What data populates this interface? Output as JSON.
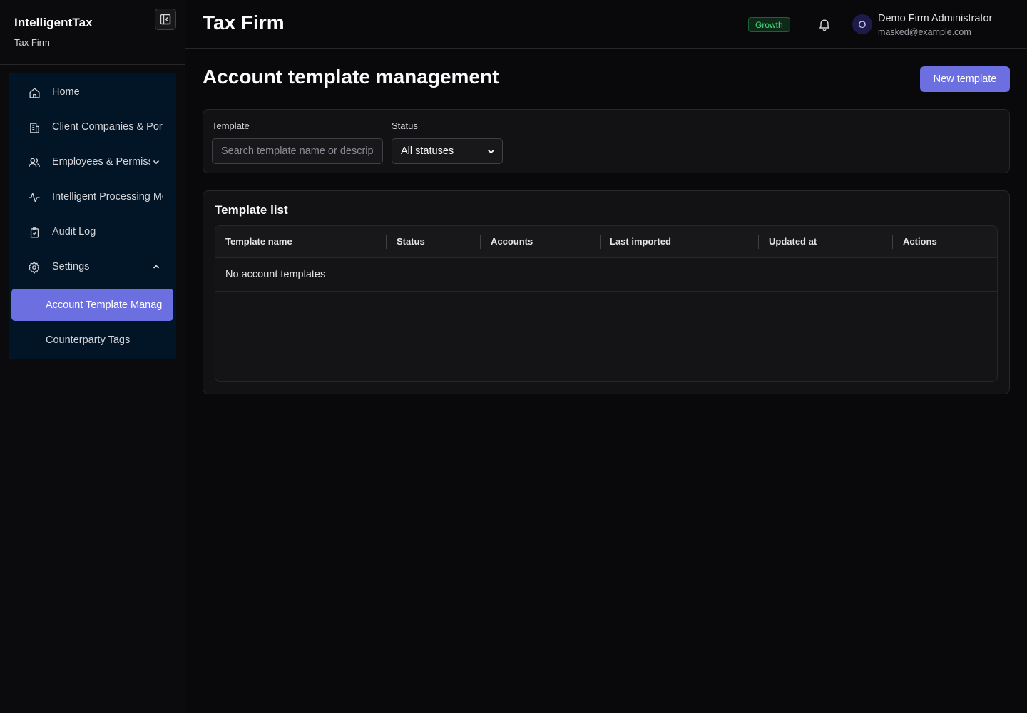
{
  "brand": {
    "title": "IntelligentTax",
    "subtitle": "Tax Firm"
  },
  "sidebar": {
    "items": [
      {
        "label": "Home",
        "icon": "home-icon"
      },
      {
        "label": "Client Companies & Portfolios",
        "icon": "building-icon"
      },
      {
        "label": "Employees & Permissions",
        "icon": "users-icon",
        "expandable": true
      },
      {
        "label": "Intelligent Processing Monitor",
        "icon": "activity-icon"
      },
      {
        "label": "Audit Log",
        "icon": "clipboard-icon"
      },
      {
        "label": "Settings",
        "icon": "gear-icon",
        "expanded": true
      }
    ],
    "sub_items": [
      {
        "label": "Account Template Management",
        "active": true
      },
      {
        "label": "Counterparty Tags",
        "active": false
      }
    ]
  },
  "header": {
    "title": "Tax Firm",
    "plan_badge": "Growth",
    "user_initial": "O",
    "user_name": "Demo Firm Administrator",
    "user_email": "masked@example.com"
  },
  "main": {
    "page_title": "Account template management",
    "new_button": "New template",
    "filters": {
      "template_label": "Template",
      "search_placeholder": "Search template name or description",
      "status_label": "Status",
      "status_value": "All statuses"
    },
    "list": {
      "title": "Template list",
      "columns": [
        "Template name",
        "Status",
        "Accounts",
        "Last imported",
        "Updated at",
        "Actions"
      ],
      "empty_text": "No account templates"
    }
  },
  "colors": {
    "accent": "#6b6fe0",
    "background": "#09090b",
    "nav_background": "#021526",
    "badge_green": "#4ade80"
  }
}
